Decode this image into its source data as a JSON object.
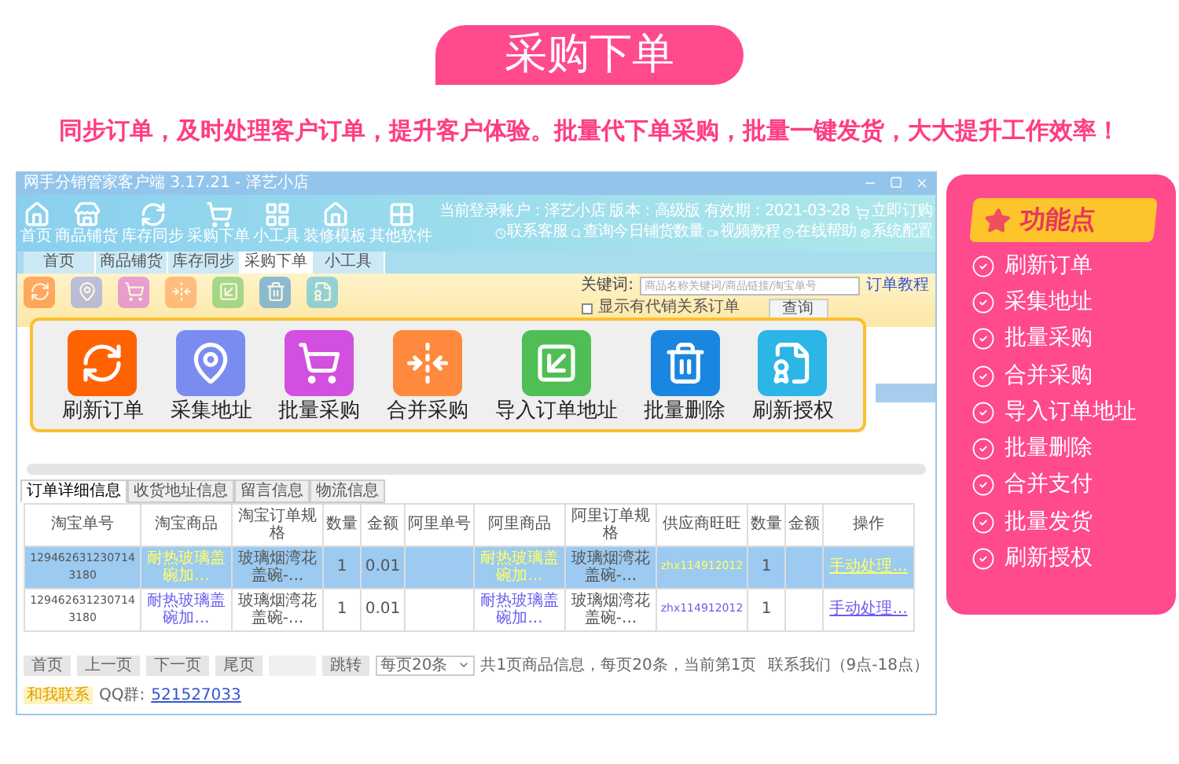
{
  "banner": {
    "title": "采购下单",
    "subtitle": "同步订单，及时处理客户订单，提升客户体验。批量代下单采购，批量一键发货，大大提升工作效率！"
  },
  "window": {
    "title": "网手分销管家客户端 3.17.21 - 泽艺小店",
    "nav": [
      "首页",
      "商品铺货",
      "库存同步",
      "采购下单",
      "小工具",
      "装修模板",
      "其他软件"
    ],
    "account": "当前登录账户：泽艺小店  版本：高级版  有效期：2021-03-28",
    "order_link": "立即订购",
    "links": [
      "联系客服",
      "查询今日铺货数量",
      "视频教程",
      "在线帮助",
      "系统配置"
    ],
    "tabs": [
      {
        "label": "首页",
        "selected": false
      },
      {
        "label": "商品铺货",
        "selected": false
      },
      {
        "label": "库存同步",
        "selected": false
      },
      {
        "label": "采购下单",
        "selected": true
      },
      {
        "label": "小工具",
        "selected": false
      }
    ],
    "keyword_label": "关键词:",
    "keyword_placeholder": "商品名称关键词/商品链接/淘宝单号",
    "tutorial_link": "订单教程",
    "checkbox": {
      "label": "显示有代销关系订单",
      "checked": false
    },
    "query_button": "查询",
    "actions": [
      "刷新订单",
      "采集地址",
      "批量采购",
      "合并采购",
      "导入订单地址",
      "批量删除",
      "刷新授权"
    ],
    "detail_tabs": [
      {
        "label": "订单详细信息",
        "selected": true
      },
      {
        "label": "收货地址信息",
        "selected": false
      },
      {
        "label": "留言信息",
        "selected": false
      },
      {
        "label": "物流信息",
        "selected": false
      }
    ],
    "table": {
      "columns": [
        "淘宝单号",
        "淘宝商品",
        "淘宝订单规格",
        "数量",
        "金额",
        "阿里单号",
        "阿里商品",
        "阿里订单规格",
        "供应商旺旺",
        "数量",
        "金额",
        "操作"
      ],
      "rows": [
        {
          "selected": true,
          "cells": [
            "1294626312307143180",
            "耐热玻璃盖碗加...",
            "玻璃烟湾花盖碗-...",
            "1",
            "0.01",
            "",
            "耐热玻璃盖碗加...",
            "玻璃烟湾花盖碗-...",
            "zhx114912012",
            "1",
            "",
            "手动处理..."
          ]
        },
        {
          "selected": false,
          "cells": [
            "1294626312307143180",
            "耐热玻璃盖碗加...",
            "玻璃烟湾花盖碗-...",
            "1",
            "0.01",
            "",
            "耐热玻璃盖碗加...",
            "玻璃烟湾花盖碗-...",
            "zhx114912012",
            "1",
            "",
            "手动处理..."
          ]
        }
      ]
    },
    "pager": {
      "buttons": [
        "首页",
        "上一页",
        "下一页",
        "尾页"
      ],
      "jump": "跳转",
      "page_size": "每页20条",
      "info": "共1页商品信息，每页20条，当前第1页",
      "contact": "联系我们（9点-18点）",
      "chat": "和我联系",
      "qq_label": "QQ群:",
      "qq": "521527033"
    }
  },
  "features": {
    "title": "功能点",
    "items": [
      "刷新订单",
      "采集地址",
      "批量采购",
      "合并采购",
      "导入订单地址",
      "批量删除",
      "合并支付",
      "批量发货",
      "刷新授权"
    ]
  }
}
